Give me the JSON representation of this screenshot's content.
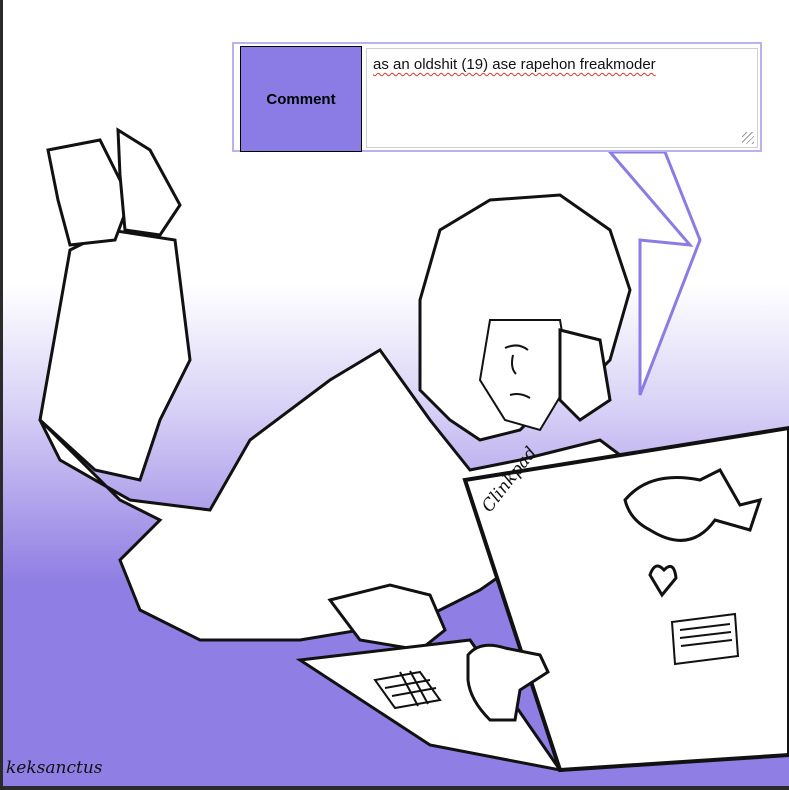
{
  "comment_form": {
    "label": "Comment",
    "value": "as an oldshit (19) ase rapehon freakmoder"
  },
  "laptop": {
    "brand": "Clinkpad"
  },
  "signature": "keksanctus",
  "colors": {
    "accent": "#8b7be5",
    "background_gradient_bottom": "#8f7ee3",
    "line": "#111111"
  }
}
